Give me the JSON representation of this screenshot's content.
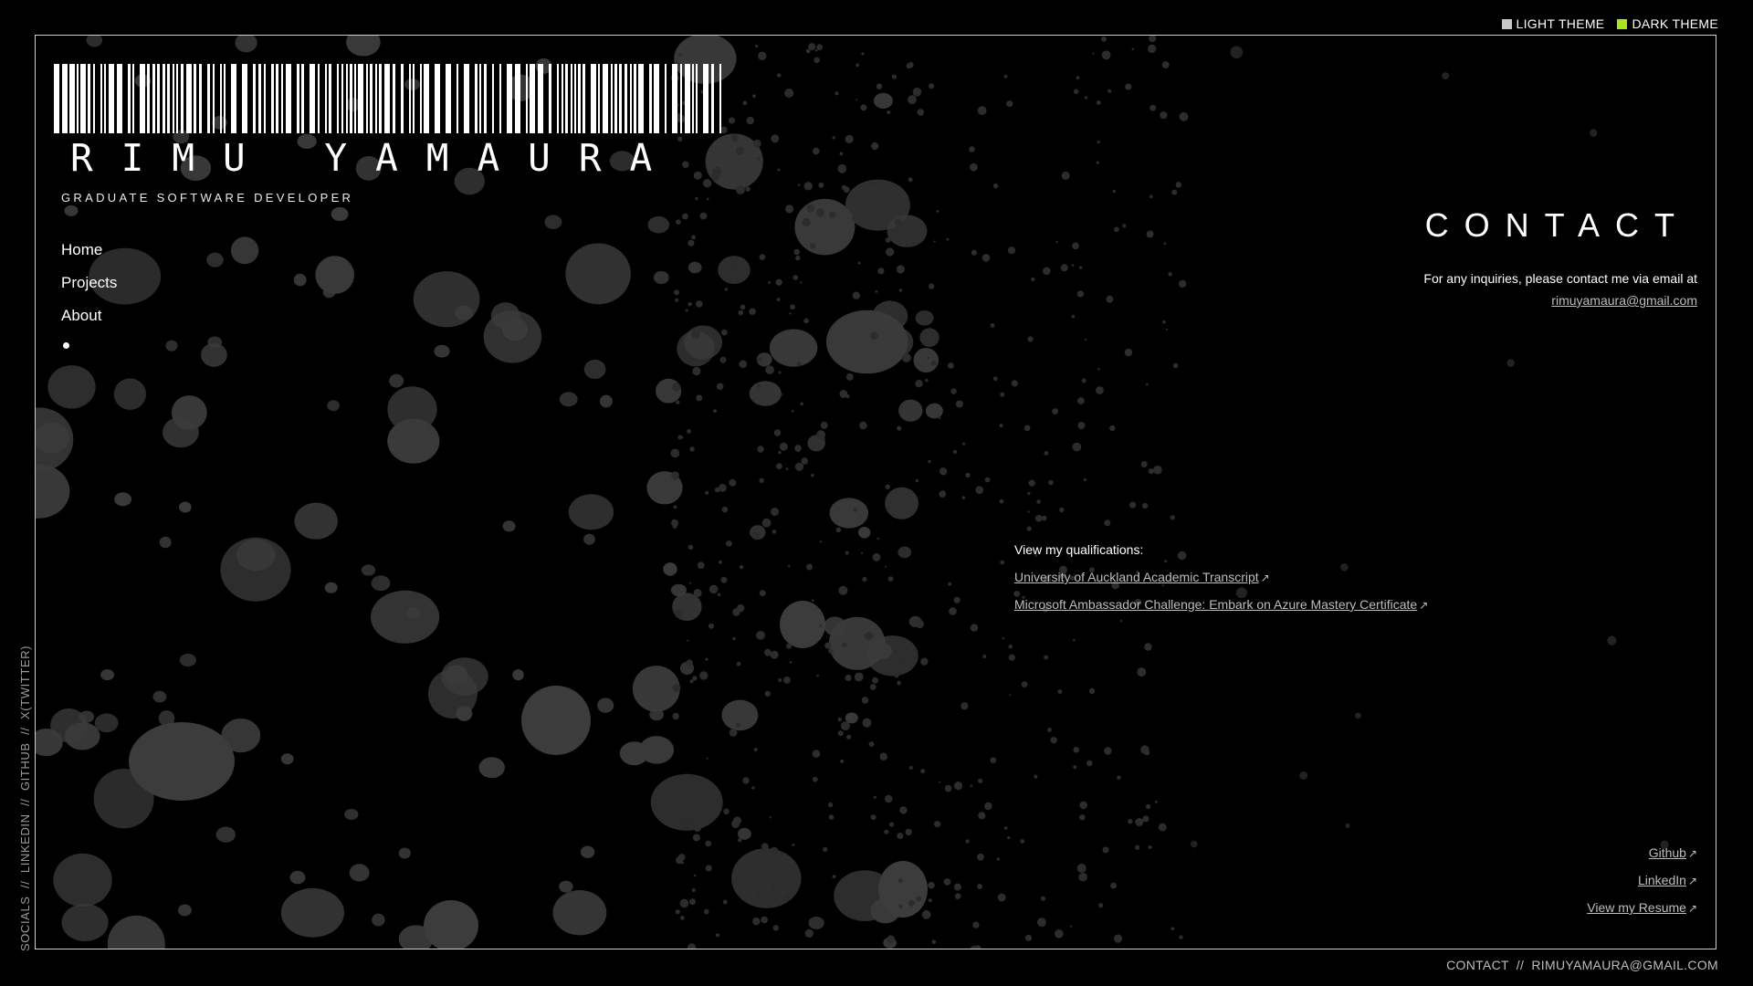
{
  "theme": {
    "light_label": "LIGHT THEME",
    "dark_label": "DARK THEME",
    "light_color": "#c8c8c8",
    "dark_color": "#a8e61d"
  },
  "header": {
    "name": "RIMU YAMAURA",
    "subtitle": "GRADUATE SOFTWARE DEVELOPER"
  },
  "nav": {
    "items": [
      "Home",
      "Projects",
      "About"
    ]
  },
  "contact": {
    "title": "CONTACT",
    "text": "For any inquiries, please contact me via email at",
    "email": "rimuyamaura@gmail.com"
  },
  "qualifications": {
    "title": "View my qualifications:",
    "links": [
      "University of Auckland Academic Transcript",
      "Microsoft Ambassador Challenge: Embark on Azure Mastery Certificate"
    ]
  },
  "links_right": [
    "Github",
    "LinkedIn",
    "View my Resume"
  ],
  "socials_vertical": {
    "label": "SOCIALS",
    "items": [
      "LINKEDIN",
      "GITHUB",
      "X(TWITTER)"
    ],
    "separator": "//"
  },
  "footer": {
    "label": "CONTACT",
    "separator": "//",
    "email": "RIMUYAMAURA@GMAIL.COM"
  },
  "icons": {
    "external": "↗"
  }
}
